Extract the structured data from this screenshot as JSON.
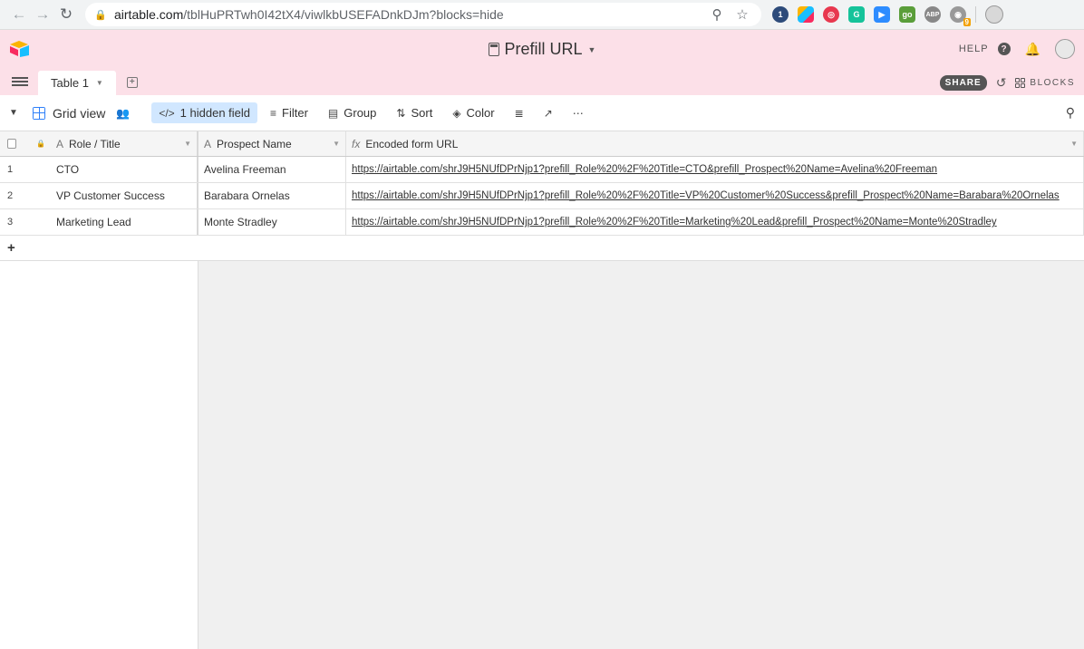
{
  "browser": {
    "url_host": "airtable.com",
    "url_path": "/tblHuPRTwh0I42tX4/viwlkbUSEFADnkDJm?blocks=hide",
    "ext_badge": "9"
  },
  "header": {
    "base_title": "Prefill URL",
    "help_label": "HELP",
    "share_label": "SHARE",
    "blocks_label": "BLOCKS",
    "table_tab": "Table 1"
  },
  "viewbar": {
    "view_name": "Grid view",
    "hidden_field": "1 hidden field",
    "filter": "Filter",
    "group": "Group",
    "sort": "Sort",
    "color": "Color"
  },
  "grid": {
    "columns": [
      "Role / Title",
      "Prospect Name",
      "Encoded form URL"
    ],
    "rows": [
      {
        "num": "1",
        "role": "CTO",
        "name": "Avelina Freeman",
        "url": "https://airtable.com/shrJ9H5NUfDPrNjp1?prefill_Role%20%2F%20Title=CTO&prefill_Prospect%20Name=Avelina%20Freeman"
      },
      {
        "num": "2",
        "role": "VP Customer Success",
        "name": "Barabara Ornelas",
        "url": "https://airtable.com/shrJ9H5NUfDPrNjp1?prefill_Role%20%2F%20Title=VP%20Customer%20Success&prefill_Prospect%20Name=Barabara%20Ornelas"
      },
      {
        "num": "3",
        "role": "Marketing Lead",
        "name": "Monte Stradley",
        "url": "https://airtable.com/shrJ9H5NUfDPrNjp1?prefill_Role%20%2F%20Title=Marketing%20Lead&prefill_Prospect%20Name=Monte%20Stradley"
      }
    ]
  },
  "colors": {
    "header_bg": "#fce0e8",
    "accent": "#2d7ff9",
    "hidden_field_bg": "#d1e7ff"
  }
}
